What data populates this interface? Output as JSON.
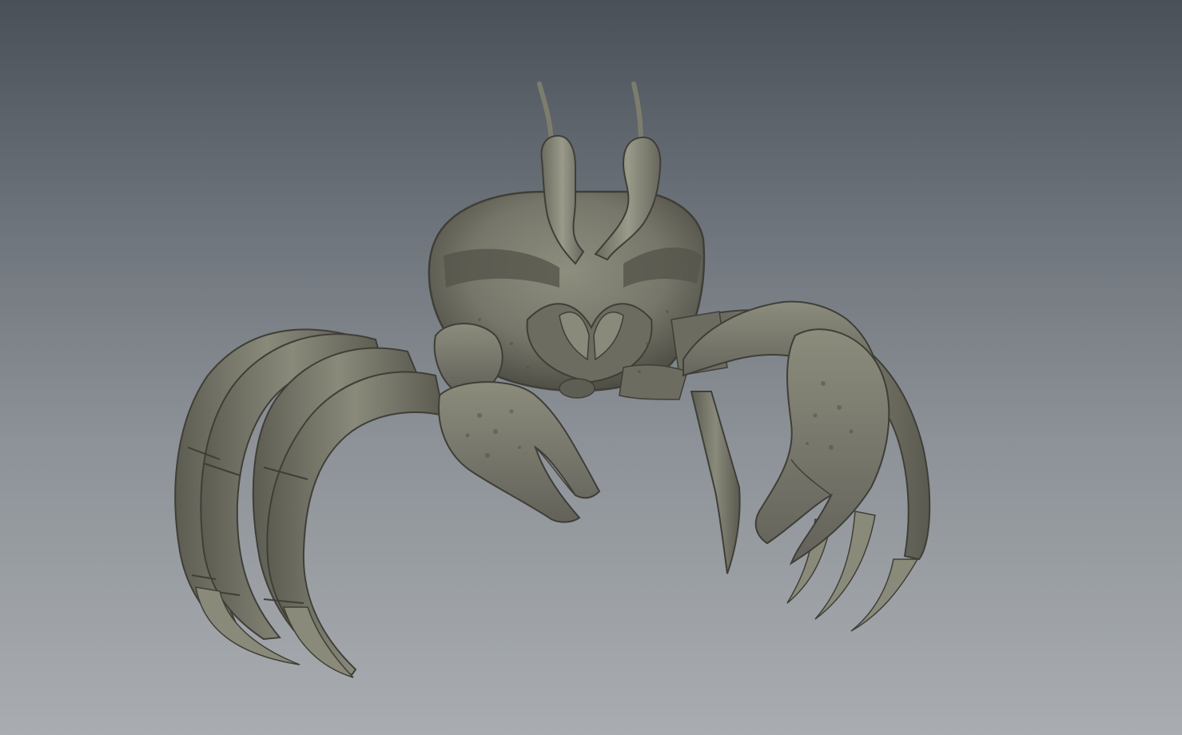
{
  "viewport": {
    "background_top": "#4a5058",
    "background_bottom": "#a9adb1"
  },
  "model": {
    "subject": "ghost-crab",
    "material_color": "#7d7d6f",
    "shadow_color": "#4b4b41",
    "highlight_color": "#a8a896"
  }
}
